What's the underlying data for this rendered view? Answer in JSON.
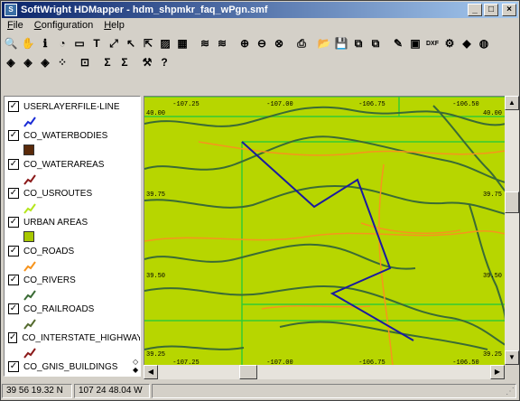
{
  "window": {
    "title": "SoftWright HDMapper - hdm_shpmkr_faq_wPgn.smf"
  },
  "menu": [
    {
      "label": "File",
      "accel": "F",
      "rest": "ile"
    },
    {
      "label": "Configuration",
      "accel": "C",
      "rest": "onfiguration"
    },
    {
      "label": "Help",
      "accel": "H",
      "rest": "elp"
    }
  ],
  "toolbar1": [
    {
      "name": "zoom-tool-icon",
      "glyph": "🔍"
    },
    {
      "name": "pan-hand-icon",
      "glyph": "✋"
    },
    {
      "name": "info-icon",
      "glyph": "ℹ"
    },
    {
      "name": "select-area-icon",
      "glyph": "◔"
    },
    {
      "name": "label-icon",
      "glyph": "▭"
    },
    {
      "name": "text-tool-icon",
      "glyph": "T"
    },
    {
      "name": "measure-icon",
      "glyph": "⤢"
    },
    {
      "name": "pointer-icon",
      "glyph": "↖"
    },
    {
      "name": "edit-pointer-icon",
      "glyph": "⇱"
    },
    {
      "name": "map-view-icon",
      "glyph": "▨"
    },
    {
      "name": "map-export-icon",
      "glyph": "▦"
    },
    {
      "name": "layers-icon",
      "glyph": "≋"
    },
    {
      "name": "layers-alt-icon",
      "glyph": "≋"
    },
    {
      "name": "zoom-in-icon",
      "glyph": "⊕"
    },
    {
      "name": "zoom-out-icon",
      "glyph": "⊖"
    },
    {
      "name": "zoom-cancel-icon",
      "glyph": "⊗"
    },
    {
      "name": "print-icon",
      "glyph": "⎙"
    },
    {
      "name": "open-folder-icon",
      "glyph": "📂"
    },
    {
      "name": "save-icon",
      "glyph": "💾"
    },
    {
      "name": "import-icon",
      "glyph": "⧉"
    },
    {
      "name": "export-icon",
      "glyph": "⧉"
    },
    {
      "name": "properties-icon",
      "glyph": "✎"
    },
    {
      "name": "db-icon",
      "glyph": "▣"
    },
    {
      "name": "dxf-icon",
      "glyph": "DXF"
    },
    {
      "name": "gear-icon",
      "glyph": "⚙"
    },
    {
      "name": "terrain-icon",
      "glyph": "◆"
    },
    {
      "name": "globe-icon",
      "glyph": "◍"
    }
  ],
  "toolbar2": [
    {
      "name": "layer-add-icon",
      "glyph": "◈"
    },
    {
      "name": "layer-style-icon",
      "glyph": "◈"
    },
    {
      "name": "layer-edit-icon",
      "glyph": "◈"
    },
    {
      "name": "points-icon",
      "glyph": "⁘"
    },
    {
      "name": "tag-icon",
      "glyph": "⊡"
    },
    {
      "name": "sum-icon",
      "glyph": "Σ"
    },
    {
      "name": "sum-selected-icon",
      "glyph": "Σ"
    },
    {
      "name": "tools-icon",
      "glyph": "⚒"
    },
    {
      "name": "help-icon",
      "glyph": "?"
    }
  ],
  "layers": [
    {
      "name": "USERLAYERFILE-LINE",
      "color": "#1a2bd6",
      "kind": "line"
    },
    {
      "name": "CO_WATERBODIES",
      "color": "#5a2a0a",
      "kind": "fill"
    },
    {
      "name": "CO_WATERAREAS",
      "color": "#8b1a1a",
      "kind": "line"
    },
    {
      "name": "CO_USROUTES",
      "color": "#b5e61d",
      "kind": "line"
    },
    {
      "name": "URBAN AREAS",
      "color": "#a8c800",
      "kind": "fill"
    },
    {
      "name": "CO_ROADS",
      "color": "#f7941d",
      "kind": "line"
    },
    {
      "name": "CO_RIVERS",
      "color": "#3a6b35",
      "kind": "line"
    },
    {
      "name": "CO_RAILROADS",
      "color": "#556b2f",
      "kind": "line"
    },
    {
      "name": "CO_INTERSTATE_HIGHWAY",
      "color": "#8b1a1a",
      "kind": "line"
    },
    {
      "name": "CO_GNIS_BUILDINGS",
      "color": "#2f6b2f",
      "kind": "line"
    }
  ],
  "map_labels": {
    "top": [
      "-107.25",
      "-107.00",
      "-106.75",
      "-106.50"
    ],
    "bottom": [
      "-107.25",
      "-107.00",
      "-106.75",
      "-106.50"
    ],
    "left": [
      "40.00",
      "39.75",
      "39.50",
      "39.25"
    ],
    "right": [
      "40.00",
      "39.75",
      "39.50",
      "39.25"
    ]
  },
  "colors": {
    "map_bg": "#b7d600",
    "grid": "#33cc33",
    "rivers": "#3a6b35",
    "roads": "#f7941d",
    "route": "#1a1aa0"
  },
  "status": {
    "lat": "39 56 19.32 N",
    "lon": "107 24 48.04 W"
  }
}
